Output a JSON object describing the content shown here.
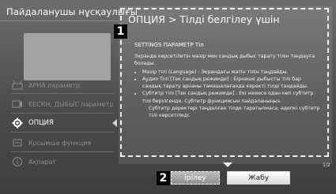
{
  "left_panel": {
    "title": "Пайдаланушы нұсқаулығы",
    "items": [
      {
        "label": "АРНА параметр",
        "icon": "antenna-icon"
      },
      {
        "label": "ЕЕСКН, ДЫБЫС параметр",
        "icon": "sound-icon"
      },
      {
        "label": "ОПЦИЯ",
        "icon": "gear-icon"
      },
      {
        "label": "Қосымша функция",
        "icon": "function-icon"
      },
      {
        "label": "Ақпарат",
        "icon": "info-icon"
      }
    ]
  },
  "popup": {
    "title": "ОПЦИЯ > Тілді белгілеу үшін",
    "breadcrumb": "SETTINGS  ПАРАМЕТР  Тіл",
    "intro": "Экранда көрсетілетін мәзір мен сандық дыбыс тарату тілін таңдауға болады.",
    "bullets": [
      "Мәзір тілі (Language) : Экрандағы мәтін тілін таңдайды.",
      "Аудио Тілі [Тек сандық режимде] : Бірнеше дыбысты тілі бар сандық тарату арнаны тамашалағанда керекті тілді таңдайды.",
      "Субтитр тілі [Тек сандық режимде] : Екі немесе одан көп субтитр тілі берілгенде, Субтитр функциясын пайдаланыңыз."
    ],
    "sub_note": "Субтитр деректері таңдалған тілде таратылмаса, әдепкі субтитр тілі көрсетіледі.",
    "page": "1/2"
  },
  "badges": {
    "one": "1",
    "two": "2"
  },
  "buttons": {
    "next": "Ірілеу",
    "close": "Жабу"
  }
}
